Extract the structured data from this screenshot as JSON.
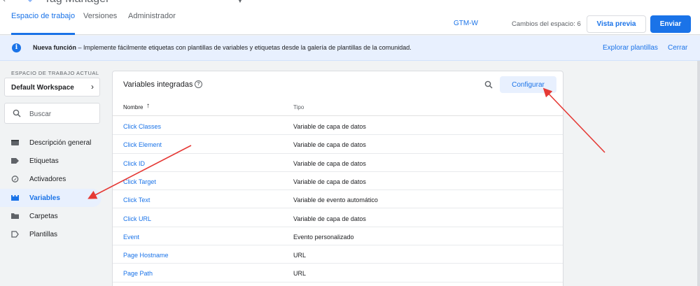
{
  "app": {
    "name": "Tag Manager"
  },
  "tabs": [
    {
      "label": "Espacio de trabajo",
      "active": true
    },
    {
      "label": "Versiones",
      "active": false
    },
    {
      "label": "Administrador",
      "active": false
    }
  ],
  "header": {
    "container_id": "GTM-W",
    "changes": "Cambios del espacio: 6",
    "preview_label": "Vista previa",
    "submit_label": "Enviar"
  },
  "banner": {
    "bold": "Nueva función",
    "text": " – Implemente fácilmente etiquetas con plantillas de variables y etiquetas desde la galería de plantillas de la comunidad.",
    "explore_label": "Explorar plantillas",
    "close_label": "Cerrar"
  },
  "sidebar": {
    "workspace_label": "ESPACIO DE TRABAJO ACTUAL",
    "workspace_name": "Default Workspace",
    "search_placeholder": "Buscar",
    "items": [
      {
        "label": "Descripción general",
        "icon": "folder-dark-icon"
      },
      {
        "label": "Etiquetas",
        "icon": "tag-icon"
      },
      {
        "label": "Activadores",
        "icon": "trigger-icon"
      },
      {
        "label": "Variables",
        "icon": "variables-icon",
        "active": true
      },
      {
        "label": "Carpetas",
        "icon": "folder-icon"
      },
      {
        "label": "Plantillas",
        "icon": "template-icon"
      }
    ]
  },
  "card": {
    "title": "Variables integradas",
    "configure_label": "Configurar",
    "columns": {
      "name": "Nombre",
      "type": "Tipo"
    },
    "rows": [
      {
        "name": "Click Classes",
        "type": "Variable de capa de datos"
      },
      {
        "name": "Click Element",
        "type": "Variable de capa de datos"
      },
      {
        "name": "Click ID",
        "type": "Variable de capa de datos"
      },
      {
        "name": "Click Target",
        "type": "Variable de capa de datos"
      },
      {
        "name": "Click Text",
        "type": "Variable de evento automático"
      },
      {
        "name": "Click URL",
        "type": "Variable de capa de datos"
      },
      {
        "name": "Event",
        "type": "Evento personalizado"
      },
      {
        "name": "Page Hostname",
        "type": "URL"
      },
      {
        "name": "Page Path",
        "type": "URL"
      }
    ]
  },
  "colors": {
    "accent": "#1a73e8",
    "annotation": "#e53935"
  }
}
